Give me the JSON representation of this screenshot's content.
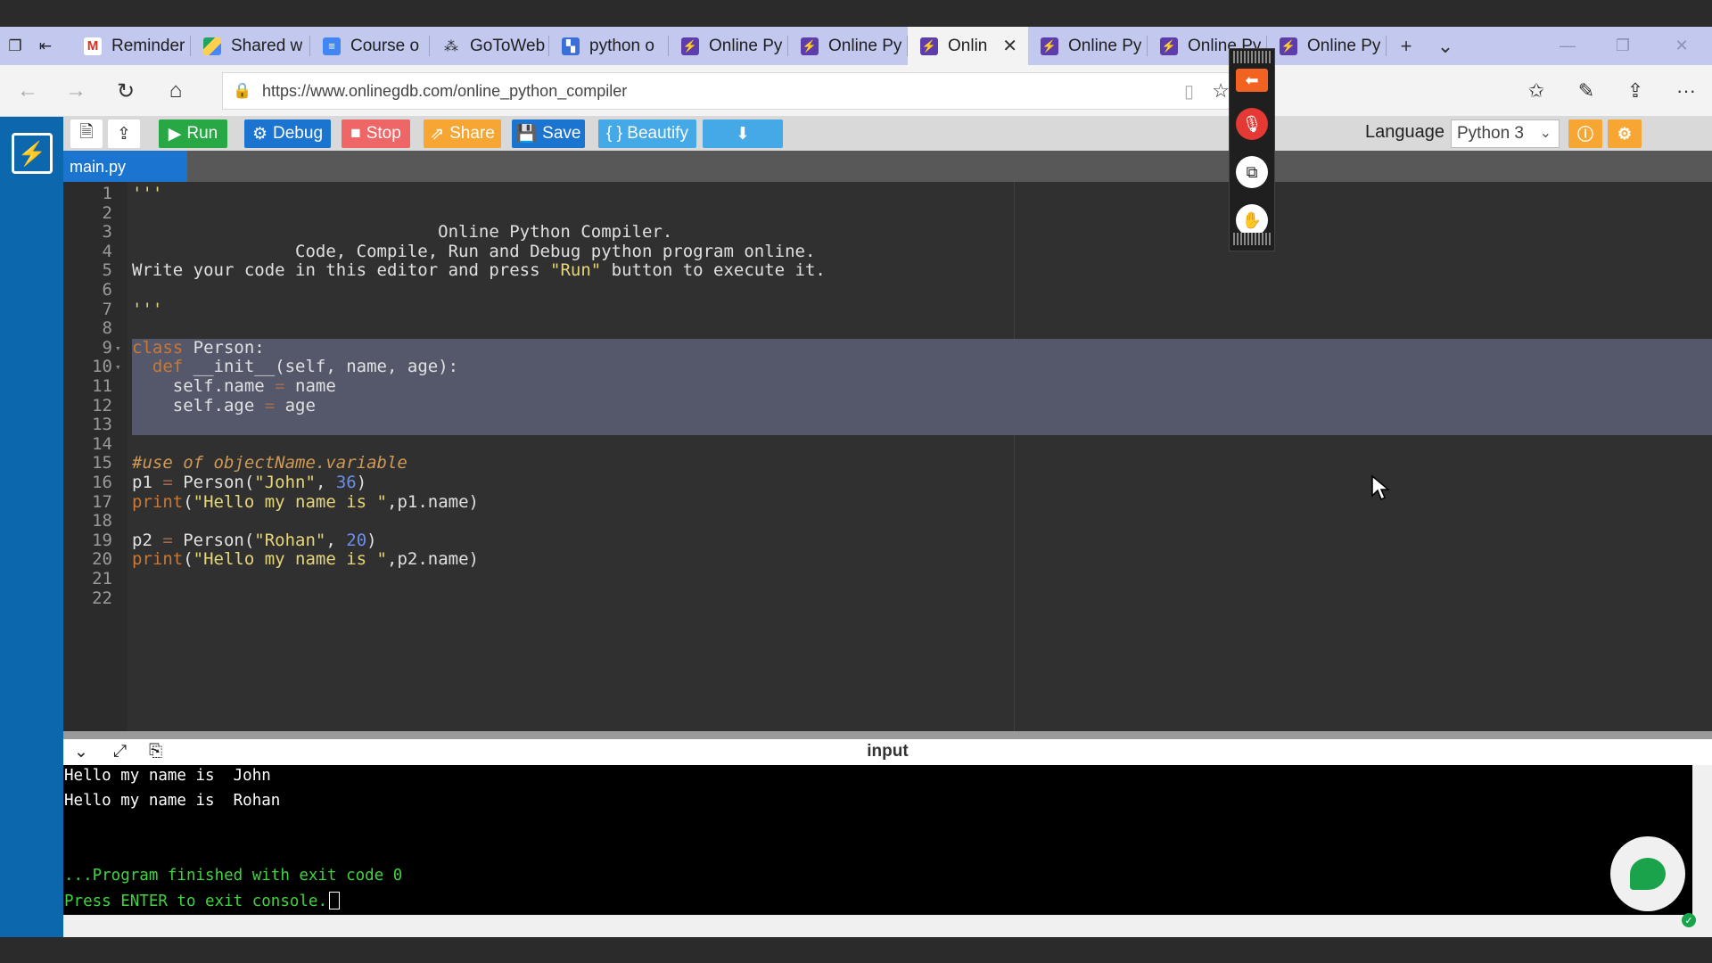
{
  "browser": {
    "tabs": [
      {
        "label": "Reminder",
        "icon": "gmail-icon"
      },
      {
        "label": "Shared w",
        "icon": "google-drive-icon"
      },
      {
        "label": "Course o",
        "icon": "google-docs-icon"
      },
      {
        "label": "GoToWeb",
        "icon": "gotowebinar-icon"
      },
      {
        "label": "python o",
        "icon": "python-docs-icon"
      },
      {
        "label": "Online Py",
        "icon": "onlinegdb-icon"
      },
      {
        "label": "Online Py",
        "icon": "onlinegdb-icon"
      },
      {
        "label": "Onlin",
        "icon": "onlinegdb-icon",
        "active": true
      },
      {
        "label": "Online Py",
        "icon": "onlinegdb-icon"
      },
      {
        "label": "Online Py",
        "icon": "onlinegdb-icon"
      },
      {
        "label": "Online Py",
        "icon": "onlinegdb-icon"
      }
    ],
    "url": "https://www.onlinegdb.com/online_python_compiler"
  },
  "toolbar": {
    "run": "Run",
    "debug": "Debug",
    "stop": "Stop",
    "share": "Share",
    "save": "Save",
    "beautify": "{ } Beautify",
    "language_label": "Language",
    "language_value": "Python 3"
  },
  "file_tab": "main.py",
  "code_lines": [
    "'''",
    "",
    "                              Online Python Compiler.",
    "                Code, Compile, Run and Debug python program online.",
    "Write your code in this editor and press \"Run\" button to execute it.",
    "",
    "'''",
    "",
    "class Person:",
    "  def __init__(self, name, age):",
    "    self.name = name",
    "    self.age = age",
    "",
    "",
    "#use of objectName.variable",
    "p1 = Person(\"John\", 36)",
    "print(\"Hello my name is \",p1.name)",
    "",
    "p2 = Person(\"Rohan\", 20)",
    "print(\"Hello my name is \",p2.name)",
    "",
    ""
  ],
  "output": {
    "title": "input",
    "lines": [
      "Hello my name is  John",
      "Hello my name is  Rohan",
      "",
      "",
      "...Program finished with exit code 0",
      "Press ENTER to exit console."
    ]
  },
  "colors": {
    "accent": "#1b75d0",
    "run": "#28a745",
    "stop": "#ee6666",
    "share": "#f7a633",
    "sidebar": "#0d67ad",
    "tabbar": "#c2c8ee"
  }
}
